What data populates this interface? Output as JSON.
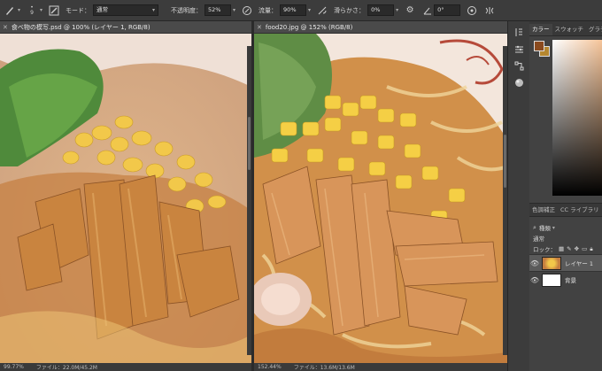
{
  "options_bar": {
    "brush_size": "9",
    "mode_label": "モード：",
    "mode_value": "通常",
    "opacity_label": "不透明度：",
    "opacity_value": "52%",
    "flow_label": "流量：",
    "flow_value": "90%",
    "smoothing_label": "滑らかさ：",
    "smoothing_value": "0%",
    "angle_value": "0°"
  },
  "documents": [
    {
      "tab_title": "食べ物の模写.psd @ 100% (レイヤー 1, RGB/8)",
      "zoom_status": "99.77%",
      "file_status": "ファイル：22.0M/45.2M"
    },
    {
      "tab_title": "food20.jpg @ 152% (RGB/8)",
      "zoom_status": "152.44%",
      "file_status": "ファイル：13.6M/13.6M"
    }
  ],
  "panels": {
    "color_tabs": [
      "カラー",
      "スウォッチ",
      "グラデ"
    ],
    "adj_tabs": [
      "色調補正",
      "CC ライブラリ"
    ],
    "kind_filter": "種類",
    "blend_mode": "通常",
    "lock_label": "ロック：",
    "layers": [
      {
        "name": "レイヤー 1",
        "selected": true
      },
      {
        "name": "背景",
        "selected": false
      }
    ]
  },
  "colors": {
    "foreground": "#8a4a1e",
    "background": "#b5872f",
    "accent": "#d9a64b"
  }
}
